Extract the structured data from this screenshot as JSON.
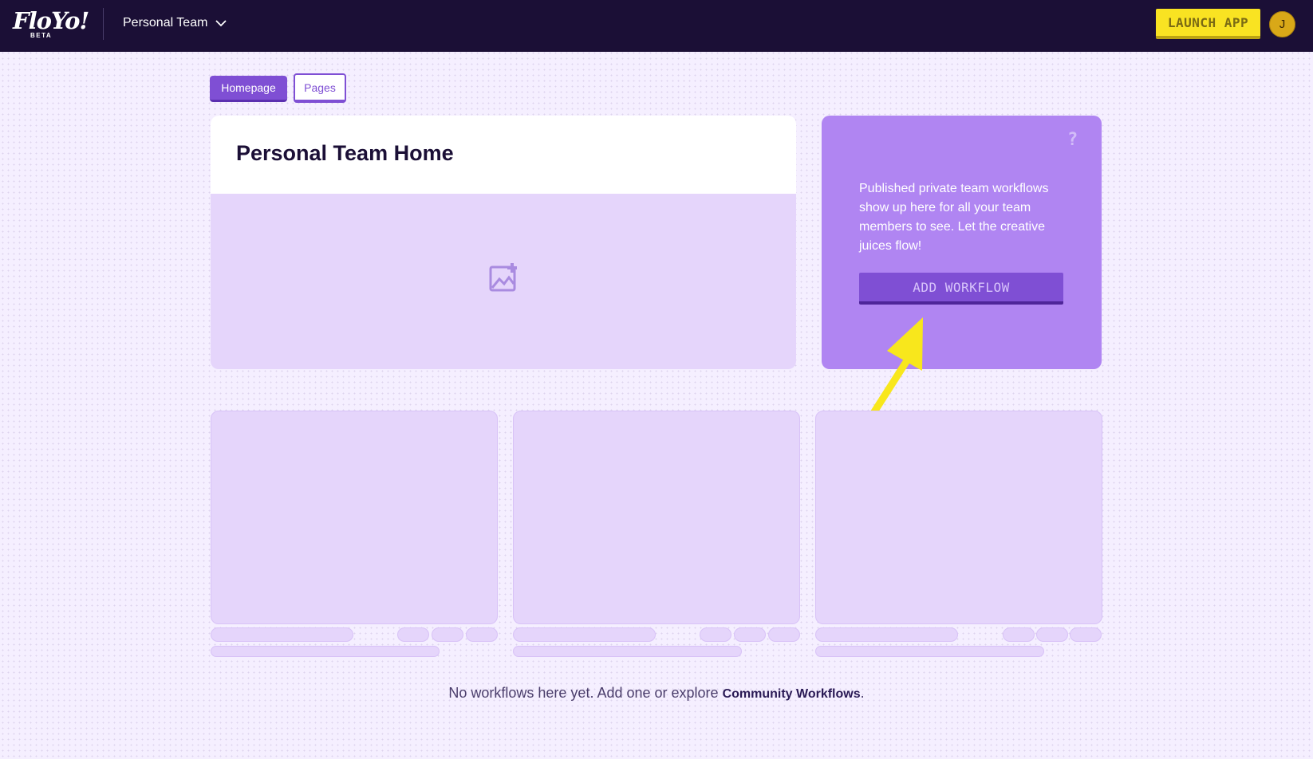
{
  "header": {
    "logo_text": "FloYo!",
    "logo_badge": "BETA",
    "team_name": "Personal Team",
    "launch_label": "LAUNCH APP",
    "avatar_initial": "J"
  },
  "tabs": [
    {
      "label": "Homepage",
      "active": true
    },
    {
      "label": "Pages",
      "active": false
    }
  ],
  "hero": {
    "title": "Personal Team Home",
    "image_icon": "add-image-icon"
  },
  "info_card": {
    "help_icon": "?",
    "text": "Published private team workflows show up here for all your team members to see. Let the creative juices flow!",
    "button_label": "ADD WORKFLOW"
  },
  "skeleton_cards_count": 3,
  "empty_state": {
    "text": "No workflows here yet. Add one or explore ",
    "link_label": "Community Workflows",
    "suffix": "."
  },
  "colors": {
    "topbar": "#1b0f36",
    "accent": "#7f4fd4",
    "card_purple": "#b085f2",
    "launch_yellow": "#f9e322",
    "annotation_arrow": "#f8e71c"
  }
}
